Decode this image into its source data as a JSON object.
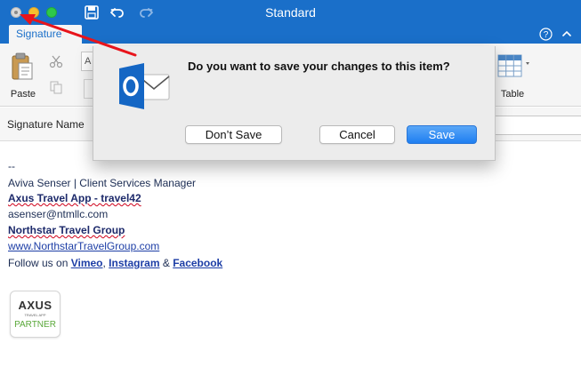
{
  "window": {
    "title": "Standard"
  },
  "ribbon": {
    "active_tab": "Signature",
    "paste_label": "Paste",
    "font_box_text": "A",
    "table_label": "Table"
  },
  "signature_row": {
    "label": "Signature Name"
  },
  "body": {
    "separator": "--",
    "name_line": "Aviva Senser | Client Services Manager",
    "company_link": "Axus Travel App - travel42",
    "email": "asenser@ntmllc.com",
    "group_link": "Northstar Travel Group",
    "website_link": "www.NorthstarTravelGroup.com",
    "follow_prefix": "Follow us on ",
    "vimeo": "Vimeo",
    "comma": ", ",
    "instagram": "Instagram",
    "amp": " & ",
    "facebook": "Facebook"
  },
  "badge": {
    "brand": "AXUS",
    "sub": "TRAVEL APP",
    "partner": "PARTNER"
  },
  "dialog": {
    "message": "Do you want to save your changes to this item?",
    "dont_save_label": "Don’t Save",
    "cancel_label": "Cancel",
    "save_label": "Save"
  },
  "colors": {
    "titlebar": "#1a6fc9",
    "save_button": "#1e7ef1",
    "annotation_arrow": "#e8141b"
  }
}
